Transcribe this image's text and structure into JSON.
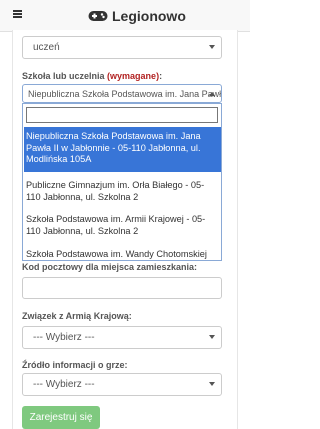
{
  "header": {
    "brand": "Legionowo"
  },
  "form": {
    "role_select_value": "uczeń",
    "school_label": "Szkoła lub uczelnia",
    "school_required": "(wymagane)",
    "school_label_colon": ":",
    "school_select_value": "Niepubliczna Szkoła Podstawowa im. Jana Pawł...",
    "school_options": [
      {
        "line1": "Niepubliczna Szkoła Podstawowa im. Jana",
        "line2": "Pawła II w Jabłonnie - 05-110 Jabłonna, ul.",
        "line3": "Modlińska 105A"
      },
      {
        "line1": "Publiczne Gimnazjum im. Orła Białego - 05-",
        "line2": "110 Jabłonna, ul. Szkolna 2"
      },
      {
        "line1": "Szkoła Podstawowa im. Armii Krajowej - 05-",
        "line2": "110 Jabłonna, ul. Szkolna 2"
      },
      {
        "line1": "Szkoła Podstawowa im. Wandy Chotomskiej"
      }
    ],
    "postal_label": "Kod pocztowy dla miejsca zamieszkania:",
    "union_label": "Związek z Armią Krajową:",
    "union_value": "--- Wybierz ---",
    "source_label": "Źródło informacji o grze:",
    "source_value": "--- Wybierz ---",
    "submit_label": "Zarejestruj się"
  }
}
